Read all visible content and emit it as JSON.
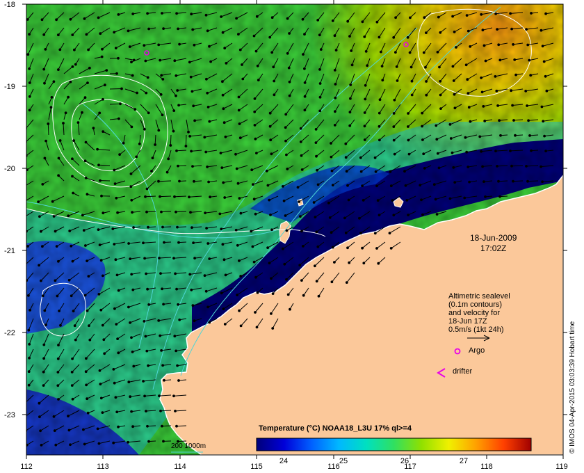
{
  "map": {
    "x_ticks": [
      "112",
      "113",
      "114",
      "115",
      "116",
      "117",
      "118",
      "119"
    ],
    "y_ticks": [
      "-18",
      "-19",
      "-20",
      "-21",
      "-22",
      "-23"
    ],
    "lon_range": [
      112,
      119
    ],
    "lat_range": [
      -23.5,
      -18
    ],
    "colors": {
      "land": "#fbc89a",
      "frame": "#000000",
      "contour": "#ffffff",
      "bathymetry": "#4fd6d6"
    }
  },
  "date": {
    "line1": "18-Jun-2009",
    "line2": "17:02Z"
  },
  "legend": {
    "line1": "Altimetric sealevel",
    "line2": "(0.1m contours)",
    "line3": "and velocity for",
    "line4": "18-Jun 17Z",
    "line5": "0.5m/s (1kt 24h)",
    "argo_label": "Argo",
    "drifter_label": "drifter",
    "argo_color": "#e800e8",
    "drifter_color": "#e800e8"
  },
  "colorbar": {
    "title": "Temperature (°C) NOAA18_L3U 17% ql>=4",
    "ticks": [
      "24",
      "25",
      "26",
      "27"
    ],
    "range": [
      23.4,
      27.9
    ],
    "colors": [
      "#00007a",
      "#0000d8",
      "#0060ff",
      "#00b8ff",
      "#00e0c0",
      "#30e060",
      "#90e000",
      "#f0f000",
      "#ffa000",
      "#ff4000",
      "#a00000"
    ]
  },
  "scale_bar": {
    "label": "200  1000m"
  },
  "credit": "© IMOS 04-Apr-2015 03:03:39 Hobart time"
}
